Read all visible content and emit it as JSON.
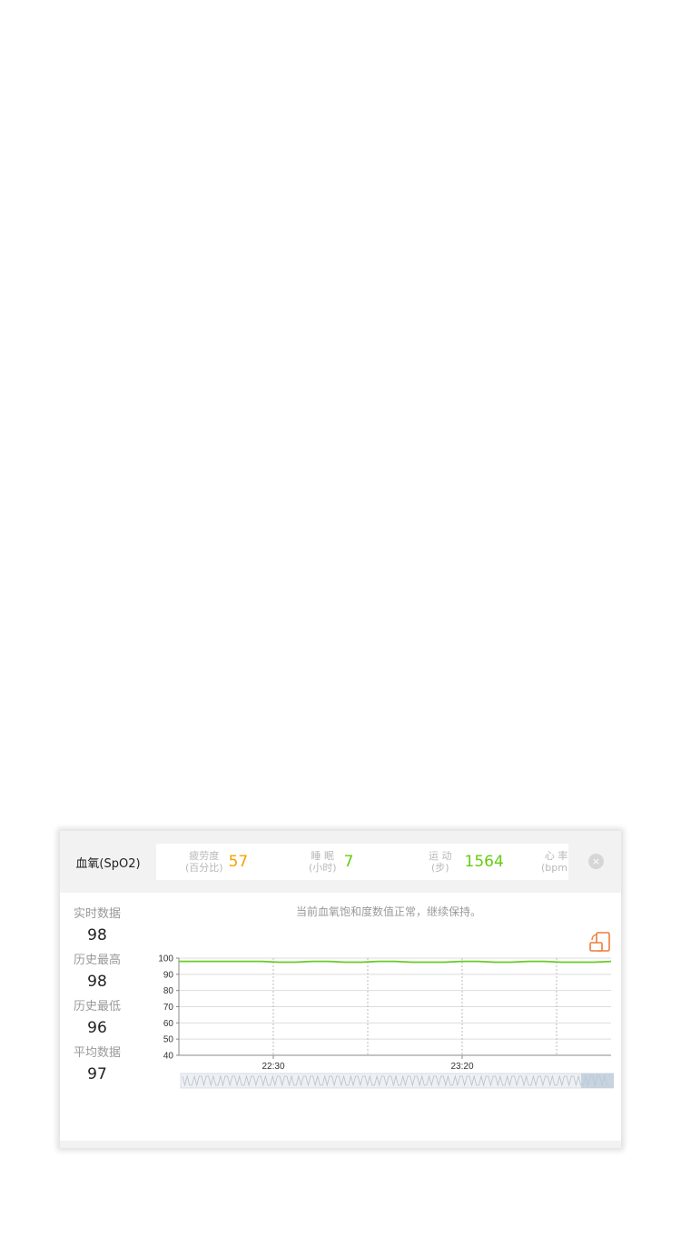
{
  "header": {
    "active_tab": "血氧(SpO2)",
    "metrics": [
      {
        "label_line1": "疲劳度",
        "label_line2": "(百分比)",
        "value": "57",
        "color": "#f0a500"
      },
      {
        "label_line1": "睡 眠",
        "label_line2": "(小时)",
        "value": "7",
        "color": "#66cc11"
      },
      {
        "label_line1": "运 动",
        "label_line2": "(步)",
        "value": "1564",
        "color": "#66cc11"
      },
      {
        "label_line1": "心 率",
        "label_line2": "(bpm)",
        "value": "",
        "color": "#66cc11"
      }
    ],
    "close_icon": "close-icon",
    "close_symbol": "×"
  },
  "stats": {
    "realtime_label": "实时数据",
    "realtime_value": "98",
    "max_label": "历史最高",
    "max_value": "98",
    "min_label": "历史最低",
    "min_value": "96",
    "avg_label": "平均数据",
    "avg_value": "97"
  },
  "notice": "当前血氧饱和度数值正常，继续保持。",
  "chart_icon": "landscape-rotate-icon",
  "chart_data": {
    "type": "line",
    "ylim": [
      40,
      100
    ],
    "yticks": [
      "100",
      "90",
      "80",
      "70",
      "60",
      "50",
      "40"
    ],
    "xticks": [
      "22:30",
      "23:20"
    ],
    "series": [
      {
        "values": [
          98,
          98,
          98,
          98,
          98,
          98,
          97.5,
          97.5,
          98,
          98,
          97.5,
          97.5,
          98,
          98,
          97.5,
          97.5,
          97.5,
          98,
          98,
          97.5,
          97.5,
          98,
          98,
          97.5,
          97.5,
          97.5,
          98
        ]
      }
    ],
    "line_color": "#66cc22",
    "grid": true
  }
}
